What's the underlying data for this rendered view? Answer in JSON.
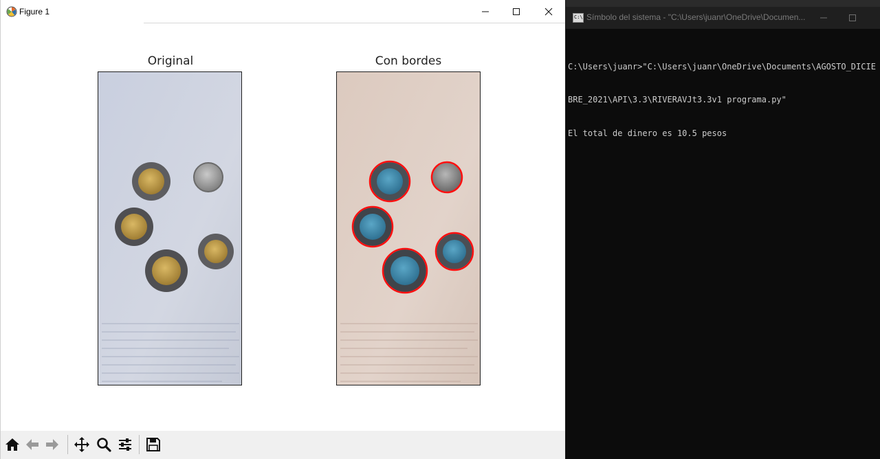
{
  "figure_window": {
    "title": "Figure 1",
    "controls": {
      "minimize_icon": "minimize-icon",
      "maximize_icon": "maximize-icon",
      "close_icon": "close-icon"
    },
    "subplots": [
      {
        "title": "Original",
        "tint": "#c9cfde"
      },
      {
        "title": "Con bordes",
        "tint": "#dbc9c0",
        "coin_tint": "#3f8fb0",
        "edge_color": "#ff1010"
      }
    ],
    "toolbar": {
      "icons": [
        "home-icon",
        "back-arrow-icon",
        "forward-arrow-icon",
        "pan-icon",
        "zoom-icon",
        "configure-subplots-icon",
        "save-icon"
      ]
    }
  },
  "console_window": {
    "title": "Símbolo del sistema - \"C:\\Users\\juanr\\OneDrive\\Documen...",
    "lines": [
      "C:\\Users\\juanr>\"C:\\Users\\juanr\\OneDrive\\Documents\\AGOSTO_DICIE",
      "BRE_2021\\API\\3.3\\RIVERAVJt3.3v1 programa.py\"",
      "El total de dinero es 10.5 pesos"
    ]
  }
}
